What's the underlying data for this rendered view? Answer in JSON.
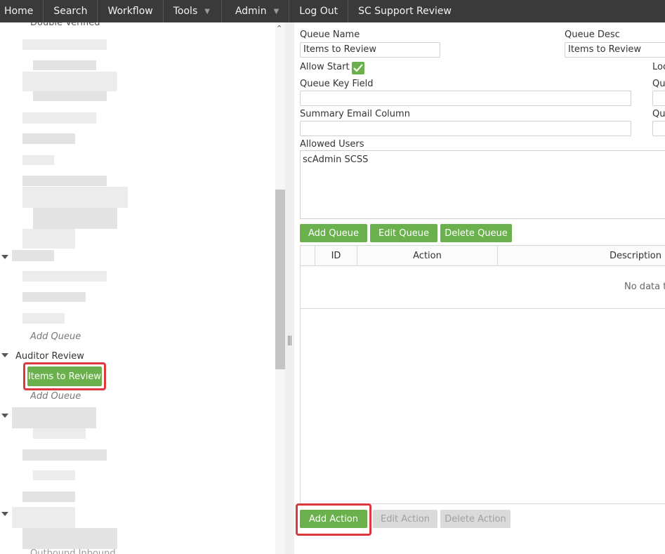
{
  "nav": {
    "items": [
      {
        "label": "Home"
      },
      {
        "label": "Search"
      },
      {
        "label": "Workflow"
      },
      {
        "label": "Tools"
      },
      {
        "label": "Admin"
      },
      {
        "label": "Log Out"
      },
      {
        "label": "SC Support Review"
      }
    ]
  },
  "tree": {
    "top_partial_label": "Double Verified",
    "add_queue_1": "Add Queue",
    "auditor_group": "Auditor Review",
    "selected_queue": "Items to Review",
    "add_queue_2": "Add Queue",
    "bottom_partial_label": "Outbound Inbound"
  },
  "form": {
    "queue_name_label": "Queue Name",
    "queue_name_value": "Items to Review",
    "queue_desc_label": "Queue Desc",
    "queue_desc_value": "Items to Review",
    "allow_start_label": "Allow Start",
    "allow_start_checked": true,
    "lock_label_partial": "Loc",
    "queue_key_field_label": "Queue Key Field",
    "queue_key_field_value": "",
    "right_label_partial_1": "Qu",
    "summary_email_label": "Summary Email Column",
    "summary_email_value": "",
    "right_label_partial_2": "Qu",
    "allowed_users_label": "Allowed Users",
    "allowed_users_value": "scAdmin SCSS"
  },
  "queue_buttons": {
    "add": "Add Queue",
    "edit": "Edit Queue",
    "delete": "Delete Queue"
  },
  "actions_grid": {
    "columns": [
      "ID",
      "Action",
      "Description"
    ],
    "empty_text": "No data t"
  },
  "action_buttons": {
    "add": "Add Action",
    "edit": "Edit Action",
    "delete": "Delete Action"
  },
  "colors": {
    "nav_bg": "#3a3a3a",
    "accent_green": "#6ab04c",
    "highlight_red": "#d9393e",
    "disabled_gray": "#dadada"
  }
}
